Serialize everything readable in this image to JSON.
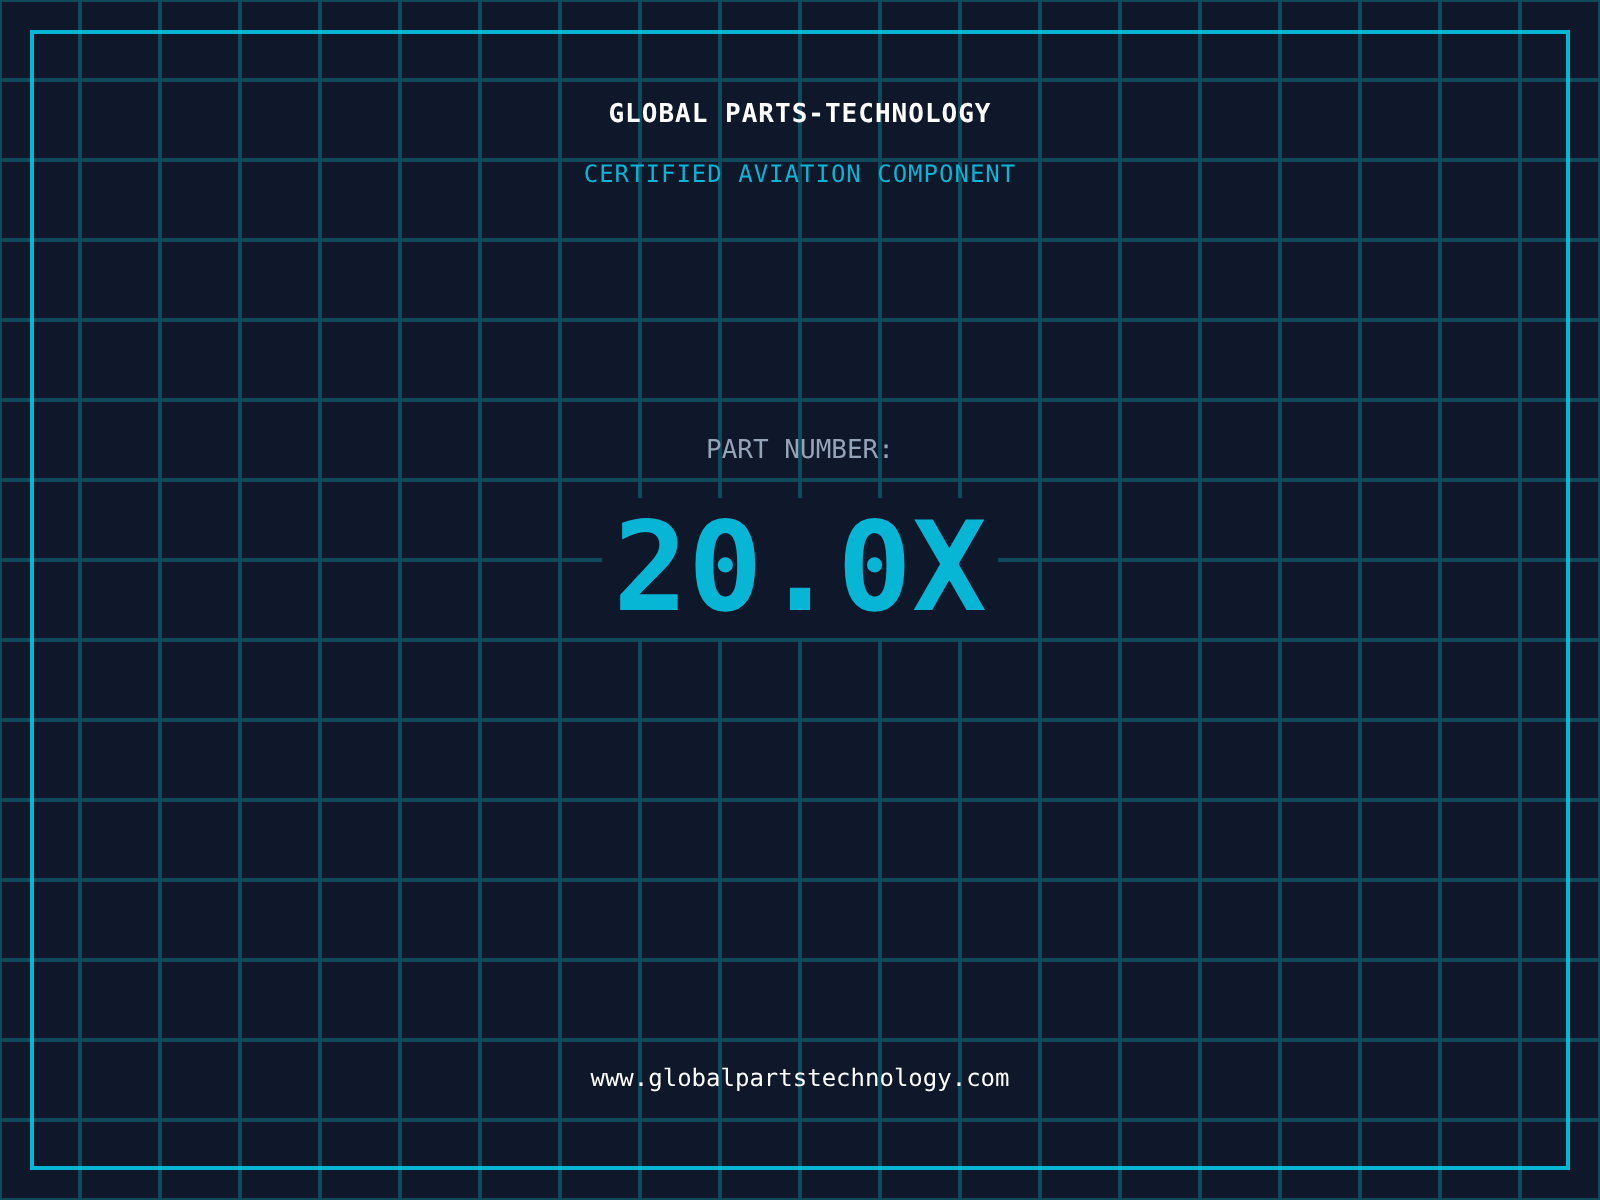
{
  "header": {
    "title": "GLOBAL PARTS-TECHNOLOGY",
    "subtitle": "CERTIFIED AVIATION COMPONENT"
  },
  "part": {
    "label": "PART NUMBER:",
    "number": "20.0X"
  },
  "footer": {
    "url": "www.globalpartstechnology.com"
  }
}
